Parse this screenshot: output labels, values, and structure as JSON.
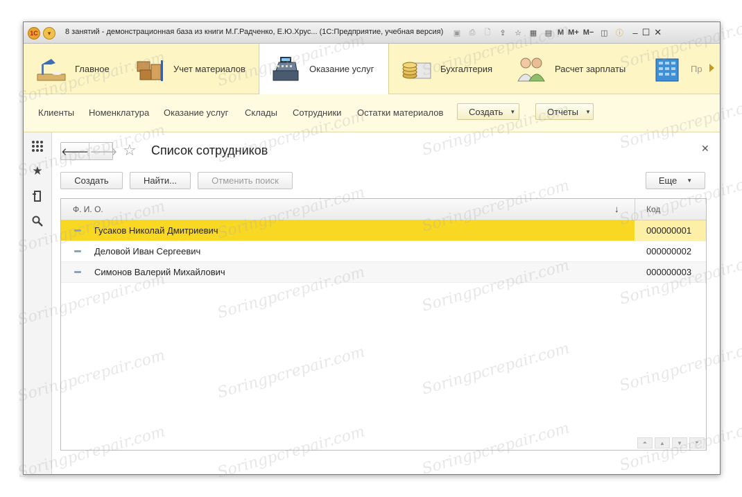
{
  "window": {
    "title": "8 занятий - демонстрационная база из книги М.Г.Радченко, Е.Ю.Хрус... (1С:Предприятие, учебная версия)",
    "toolbar_text": [
      "M",
      "M+",
      "M−"
    ]
  },
  "sections": [
    {
      "label": "Главное"
    },
    {
      "label": "Учет материалов"
    },
    {
      "label": "Оказание услуг",
      "active": true
    },
    {
      "label": "Бухгалтерия"
    },
    {
      "label": "Расчет зарплаты"
    },
    {
      "label": "Пр"
    }
  ],
  "commands": {
    "links": [
      "Клиенты",
      "Номенклатура",
      "Оказание услуг",
      "Склады",
      "Сотрудники",
      "Остатки материалов"
    ],
    "create_label": "Создать",
    "reports_label": "Отчеты"
  },
  "form": {
    "title": "Список сотрудников",
    "create_label": "Создать",
    "find_label": "Найти...",
    "cancel_search_label": "Отменить поиск",
    "more_label": "Еще"
  },
  "table": {
    "columns": [
      "Ф. И. О.",
      "Код"
    ],
    "sort_indicator": "↓",
    "rows": [
      {
        "name": "Гусаков Николай Дмитриевич",
        "code": "000000001",
        "selected": true
      },
      {
        "name": "Деловой Иван Сергеевич",
        "code": "000000002"
      },
      {
        "name": "Симонов Валерий Михайлович",
        "code": "000000003"
      }
    ]
  },
  "watermark": "Soringpcrepair.com",
  "colors": {
    "sections_bg": "#fdf5c4",
    "selected_row": "#f9d824",
    "accent": "#c49a18"
  }
}
